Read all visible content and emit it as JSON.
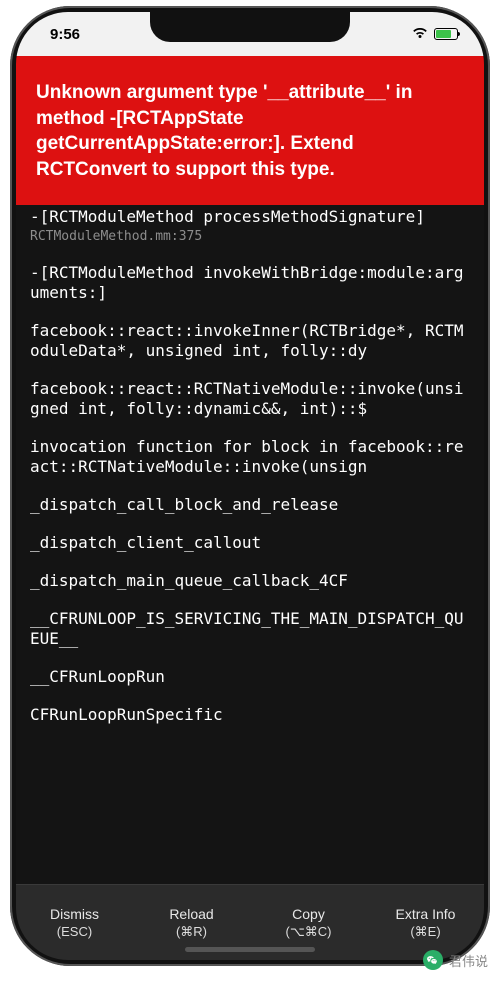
{
  "status": {
    "time": "9:56"
  },
  "error": {
    "message": "Unknown argument type '__attribute__' in method -[RCTAppState getCurrentAppState:error:]. Extend RCTConvert to support this type."
  },
  "stack": [
    {
      "fn": "-[RCTModuleMethod processMethodSignature]",
      "loc": "RCTModuleMethod.mm:375"
    },
    {
      "fn": "-[RCTModuleMethod invokeWithBridge:module:arguments:]",
      "loc": ""
    },
    {
      "fn": "facebook::react::invokeInner(RCTBridge*, RCTModuleData*, unsigned int, folly::dy",
      "loc": ""
    },
    {
      "fn": "facebook::react::RCTNativeModule::invoke(unsigned int, folly::dynamic&&, int)::$",
      "loc": ""
    },
    {
      "fn": "invocation function for block in facebook::react::RCTNativeModule::invoke(unsign",
      "loc": ""
    },
    {
      "fn": "_dispatch_call_block_and_release",
      "loc": ""
    },
    {
      "fn": "_dispatch_client_callout",
      "loc": ""
    },
    {
      "fn": "_dispatch_main_queue_callback_4CF",
      "loc": ""
    },
    {
      "fn": "__CFRUNLOOP_IS_SERVICING_THE_MAIN_DISPATCH_QUEUE__",
      "loc": ""
    },
    {
      "fn": "__CFRunLoopRun",
      "loc": ""
    },
    {
      "fn": "CFRunLoopRunSpecific",
      "loc": ""
    }
  ],
  "toolbar": {
    "dismiss": {
      "label": "Dismiss",
      "shortcut": "(ESC)"
    },
    "reload": {
      "label": "Reload",
      "shortcut": "(⌘R)"
    },
    "copy": {
      "label": "Copy",
      "shortcut": "(⌥⌘C)"
    },
    "extra": {
      "label": "Extra Info",
      "shortcut": "(⌘E)"
    }
  },
  "watermark": {
    "text": "君伟说"
  }
}
